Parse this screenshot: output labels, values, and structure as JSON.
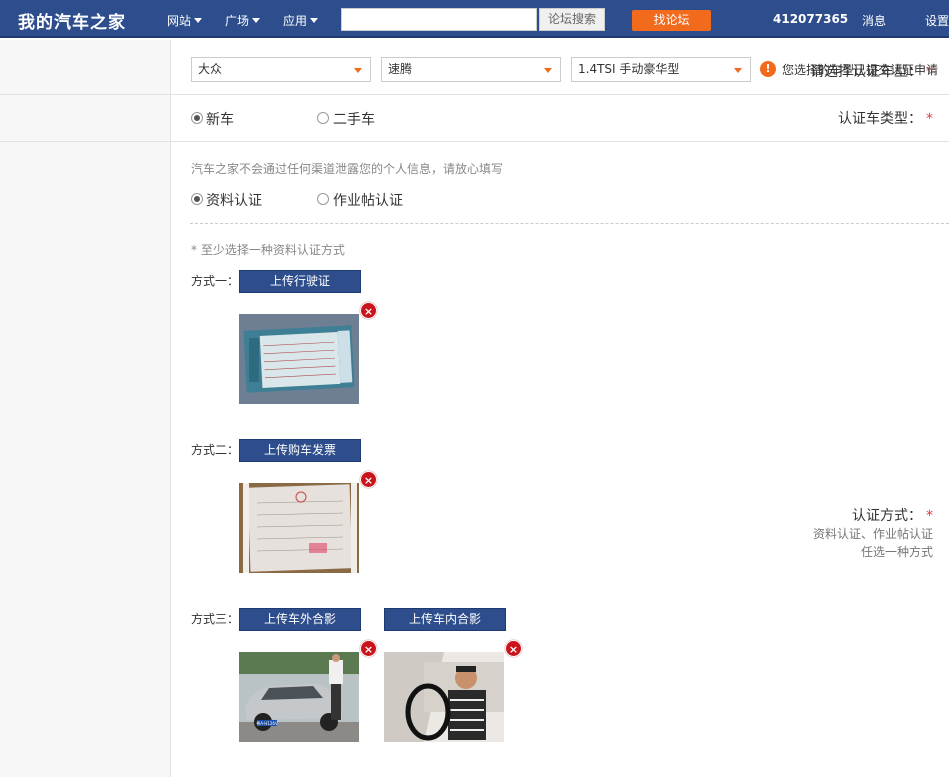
{
  "header": {
    "logo": "我的汽车之家",
    "nav": [
      "网站",
      "广场",
      "应用"
    ],
    "search_placeholder": "",
    "search_button": "论坛搜索",
    "find_button": "找论坛",
    "user_id": "412077365",
    "messages": "消息",
    "settings": "设置"
  },
  "row1": {
    "label": "请选择认证车型：",
    "star": "*",
    "brand": "大众",
    "series": "速腾",
    "model": "1.4TSI 手动豪华型",
    "warning": "您选择的车型已提交认证申请"
  },
  "row2": {
    "label": "认证车类型：",
    "star": "*",
    "options": [
      "新车",
      "二手车"
    ],
    "selected": 0
  },
  "row3": {
    "label": "认证方式：",
    "star": "*",
    "sub1": "资料认证、作业帖认证",
    "sub2": "任选一种方式",
    "notice": "汽车之家不会通过任何渠道泄露您的个人信息，请放心填写",
    "options": [
      "资料认证",
      "作业帖认证"
    ],
    "selected": 0,
    "min_hint": "* 至少选择一种资料认证方式",
    "ways": [
      {
        "label": "方式一：",
        "buttons": [
          "上传行驶证"
        ]
      },
      {
        "label": "方式二：",
        "buttons": [
          "上传购车发票"
        ]
      },
      {
        "label": "方式三：",
        "buttons": [
          "上传车外合影",
          "上传车内合影"
        ]
      }
    ],
    "plate_text": "粤A·H126V"
  },
  "colors": {
    "nav_bg": "#2d4d8c",
    "accent": "#f26b1d",
    "delete": "#c9141b",
    "required": "#e4393c"
  }
}
